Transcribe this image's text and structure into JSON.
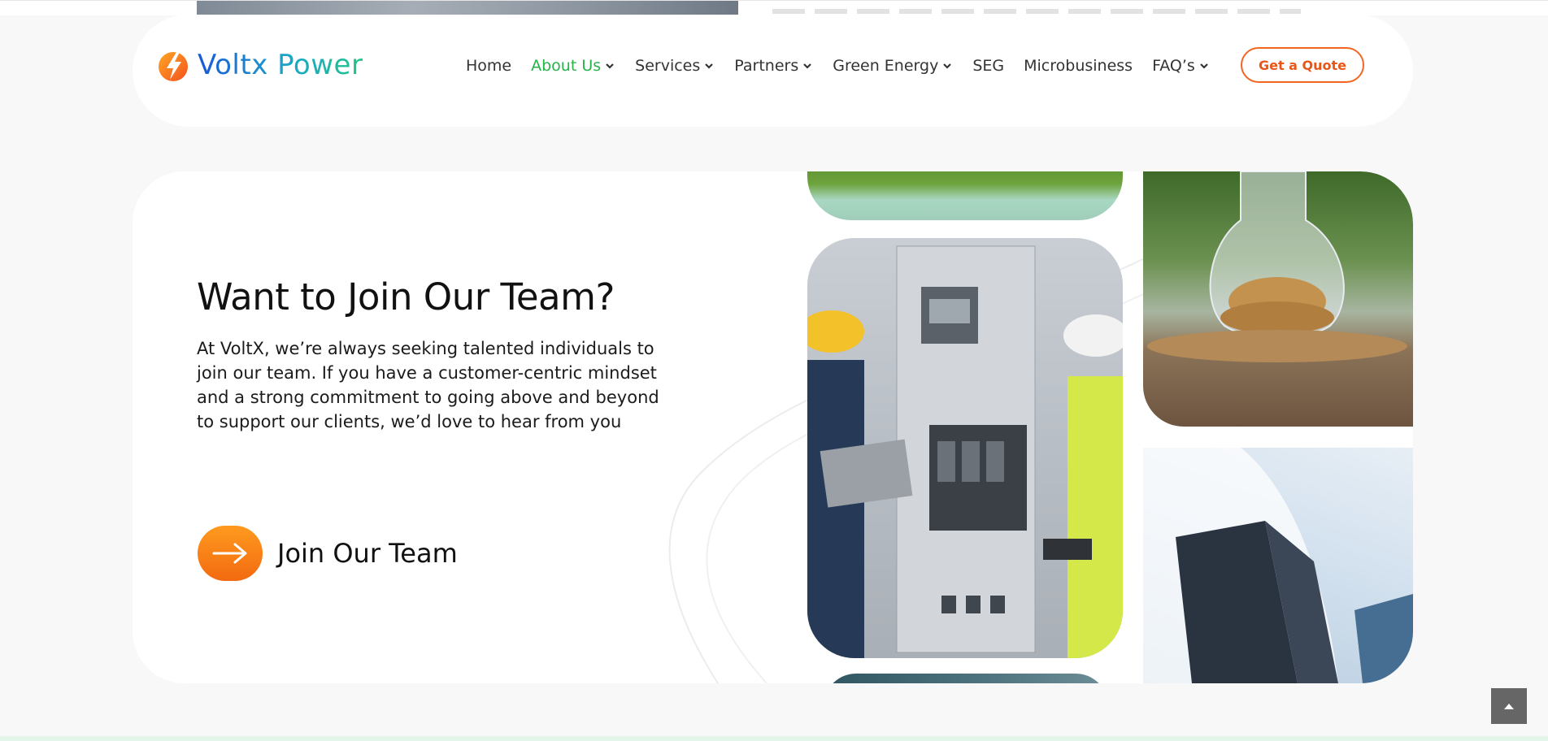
{
  "brand": {
    "name": "Voltx Power",
    "colors": {
      "primary_blue": "#1a58d6",
      "primary_green": "#21c48a",
      "accent_orange": "#f26522",
      "active_nav": "#27b24a"
    }
  },
  "nav": {
    "items": [
      {
        "label": "Home",
        "has_dropdown": false,
        "active": false
      },
      {
        "label": "About Us",
        "has_dropdown": true,
        "active": true
      },
      {
        "label": "Services",
        "has_dropdown": true,
        "active": false
      },
      {
        "label": "Partners",
        "has_dropdown": true,
        "active": false
      },
      {
        "label": "Green Energy",
        "has_dropdown": true,
        "active": false
      },
      {
        "label": "SEG",
        "has_dropdown": false,
        "active": false
      },
      {
        "label": "Microbusiness",
        "has_dropdown": false,
        "active": false
      },
      {
        "label": "FAQ’s",
        "has_dropdown": true,
        "active": false
      }
    ],
    "cta_label": "Get a Quote"
  },
  "join": {
    "heading": "Want to Join Our Team?",
    "paragraph": "At VoltX, we’re always seeking talented individuals to join our team. If you have a customer-centric mindset and a strong commitment to going above and beyond to support our clients, we’d love to hear from you",
    "cta_label": "Join Our Team",
    "cta_icon": "arrow-right-icon"
  },
  "images": {
    "tile_1": "grass-image",
    "tile_2": "engineers-switchboard-image",
    "tile_3": "teal-image",
    "tile_4": "coins-jar-image",
    "tile_5": "glass-building-image"
  },
  "scroll_top_icon": "chevron-up-icon"
}
